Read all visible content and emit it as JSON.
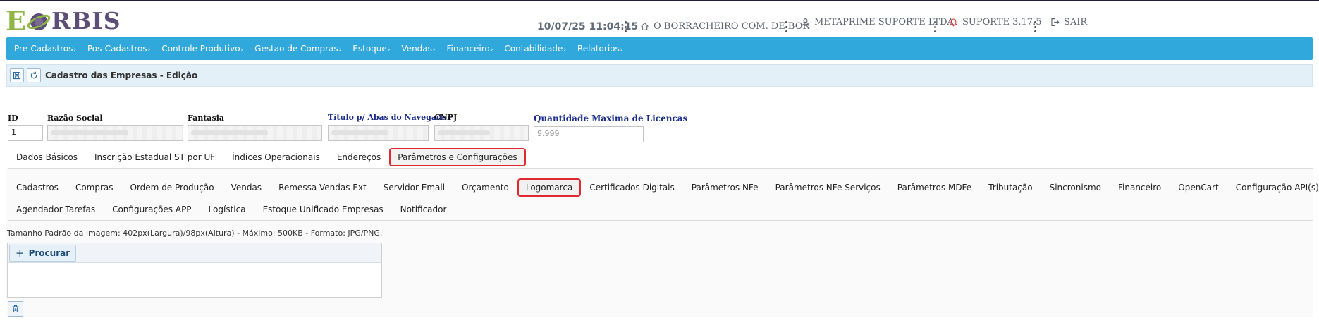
{
  "header": {
    "logo": "EORBIS",
    "datetime": "10/07/25 11:04:15",
    "company": "O BORRACHEIRO COM. DE BOR",
    "user": "METAPRIME SUPORTE LTDA",
    "support": "SUPORTE 3.17.5",
    "exit": "SAIR",
    "icons": [
      "home-icon",
      "user-icon",
      "bell-icon",
      "exit-icon"
    ]
  },
  "menu": [
    "Pre-Cadastros",
    "Pos-Cadastros",
    "Controle Produtivo",
    "Gestao de Compras",
    "Estoque",
    "Vendas",
    "Financeiro",
    "Contabilidade",
    "Relatorios"
  ],
  "menu_caret": "›",
  "page": {
    "title": "Cadastro das Empresas - Edição"
  },
  "form": {
    "id_label": "ID",
    "id_value": "1",
    "razao_label": "Razão Social",
    "fantasia_label": "Fantasia",
    "titulo_label": "Título p/ Abas do Navegador",
    "cnpj_label": "CNPJ",
    "licencas_label": "Quantidade Maxima de Licencas",
    "licencas_placeholder": "9.999"
  },
  "tabs": [
    "Dados Básicos",
    "Inscrição Estadual ST por UF",
    "Índices Operacionais",
    "Endereços",
    "Parâmetros e Configurações"
  ],
  "active_tab": "Parâmetros e Configurações",
  "subtabs_row1": [
    "Cadastros",
    "Compras",
    "Ordem de Produção",
    "Vendas",
    "Remessa Vendas Ext",
    "Servidor Email",
    "Orçamento",
    "Logomarca",
    "Certificados Digitais",
    "Parâmetros NFe",
    "Parâmetros NFe Serviços",
    "Parâmetros MDFe",
    "Tributação",
    "Sincronismo",
    "Financeiro",
    "OpenCart",
    "Configuração API(s)"
  ],
  "subtabs_row2": [
    "Agendador Tarefas",
    "Configurações APP",
    "Logística",
    "Estoque Unificado Empresas",
    "Notificador"
  ],
  "active_subtab": "Logomarca",
  "logomarca": {
    "info": "Tamanho Padrão da Imagem: 402px(Largura)/98px(Altura) - Máximo: 500KB - Formato: JPG/PNG.",
    "browse_label": "Procurar"
  },
  "colors": {
    "menubar": "#31a8dc",
    "highlight": "#e0282f",
    "logo_green": "#8fb644",
    "logo_purple": "#5d4e77"
  }
}
